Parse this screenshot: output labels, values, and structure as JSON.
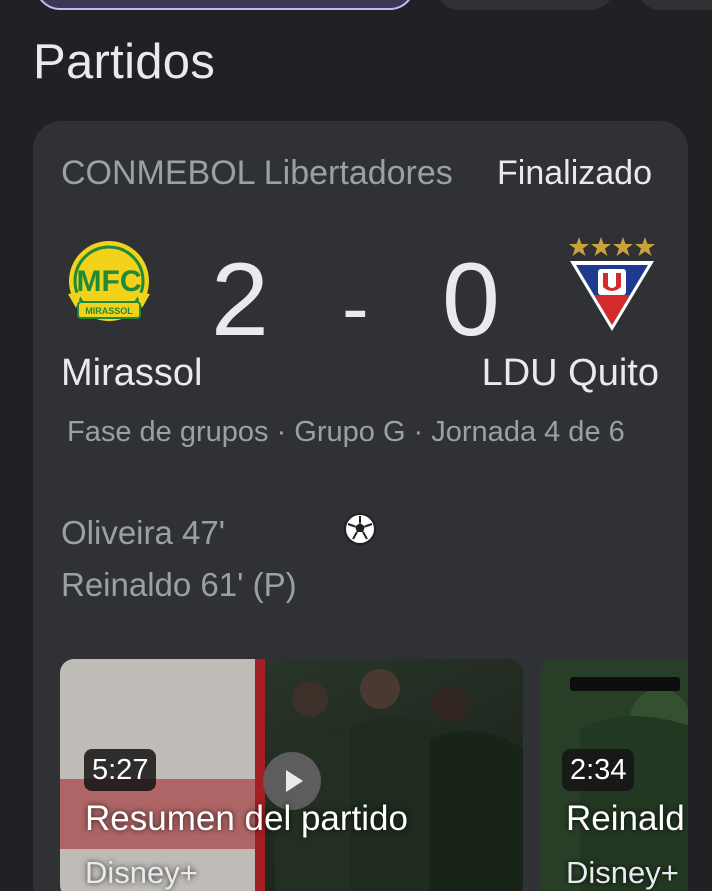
{
  "section": {
    "title": "Partidos"
  },
  "match": {
    "competition": "CONMEBOL Libertadores",
    "status": "Finalizado",
    "home": {
      "name": "Mirassol",
      "score": "2",
      "logo_icon": "mirassol-crest-icon",
      "logo_text": "MFC",
      "logo_sub": "MIRASSOL"
    },
    "away": {
      "name": "LDU Quito",
      "score": "0",
      "logo_icon": "ldu-quito-crest-icon"
    },
    "separator": "-",
    "phase": "Fase de grupos · Grupo G · Jornada 4 de 6",
    "goals": [
      {
        "text": "Oliveira 47'"
      },
      {
        "text": "Reinaldo 61' (P)"
      }
    ]
  },
  "videos": [
    {
      "duration": "5:27",
      "title": "Resumen del partido",
      "source": "Disney+"
    },
    {
      "duration": "2:34",
      "title": "Reinald",
      "source": "Disney+"
    }
  ],
  "colors": {
    "background": "#202124",
    "card": "#303134",
    "chip_accent": "#c6b8ff",
    "mirassol_yellow": "#f2d21b",
    "mirassol_green": "#1f8a3a",
    "ldu_blue": "#1d3a8f",
    "ldu_red": "#d22b2b",
    "ldu_gold": "#c9a23a"
  }
}
